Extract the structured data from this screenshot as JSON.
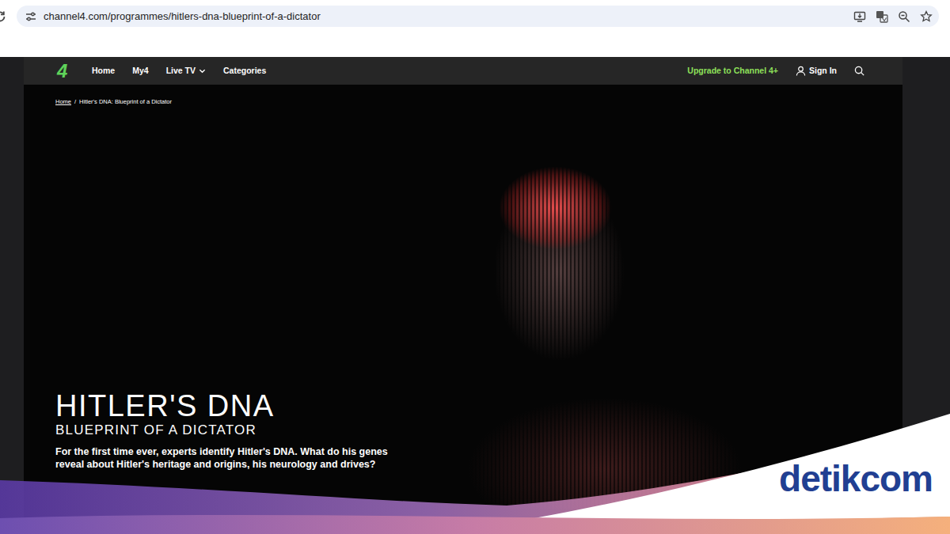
{
  "browser": {
    "address": "channel4.com/programmes/hitlers-dna-blueprint-of-a-dictator"
  },
  "site_nav": {
    "logo": "4",
    "items": [
      {
        "label": "Home",
        "dropdown": false
      },
      {
        "label": "My4",
        "dropdown": false
      },
      {
        "label": "Live TV",
        "dropdown": true
      },
      {
        "label": "Categories",
        "dropdown": false
      }
    ],
    "upgrade": "Upgrade to Channel 4+",
    "sign_in": "Sign In"
  },
  "breadcrumb": {
    "items": [
      {
        "label": "Home",
        "link": true
      },
      {
        "label": "Hitler's DNA: Blueprint of a Dictator",
        "link": false
      }
    ],
    "separator": "/"
  },
  "hero": {
    "title": "HITLER'S DNA",
    "subtitle": "BLUEPRINT OF A DICTATOR",
    "description": "For the first time ever, experts identify Hitler's DNA. What do his genes reveal about Hitler's heritage and origins, his neurology and drives?"
  },
  "watermark": {
    "text": "detikcom"
  }
}
